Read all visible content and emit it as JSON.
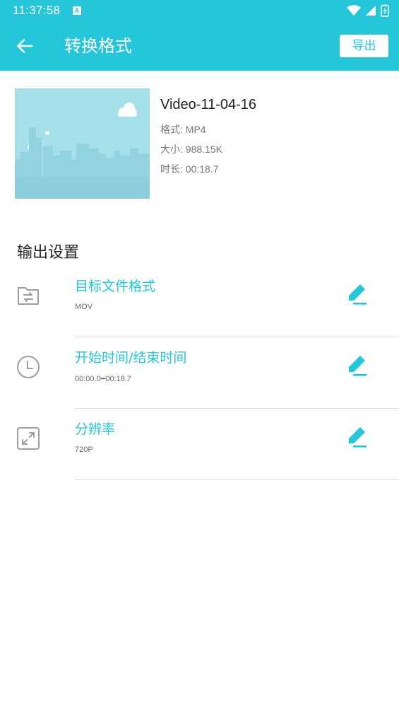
{
  "status_bar": {
    "time": "11:37:58",
    "badge": "A"
  },
  "app_bar": {
    "title": "转换格式",
    "export_label": "导出"
  },
  "video": {
    "title": "Video-11-04-16",
    "format": "格式: MP4",
    "size": "大小: 988.15K",
    "duration": "时长: 00:18.7"
  },
  "section": {
    "title": "输出设置"
  },
  "settings": [
    {
      "title": "目标文件格式",
      "value": "MOV",
      "icon": "folder-convert-icon"
    },
    {
      "title": "开始时间/结束时间",
      "value": "00:00.0━00:18.7",
      "icon": "clock-icon"
    },
    {
      "title": "分辨率",
      "value": "720P",
      "icon": "expand-icon"
    }
  ],
  "colors": {
    "accent": "#26c6da",
    "thumbnail_bg": "#a5dfea"
  }
}
